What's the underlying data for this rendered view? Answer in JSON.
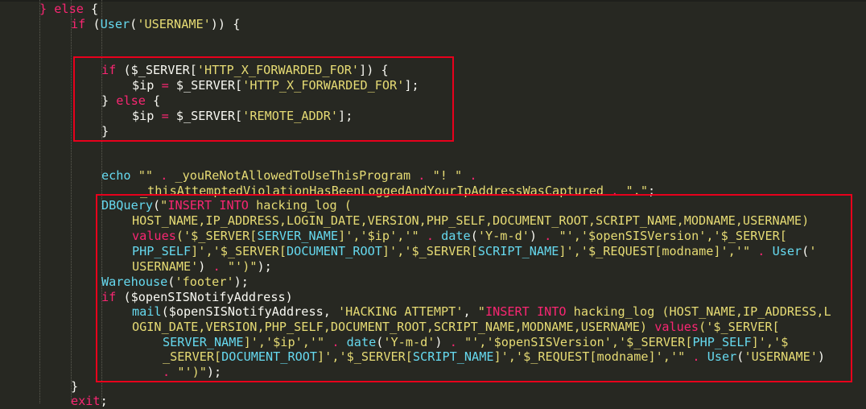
{
  "colors": {
    "background": "#272822",
    "text": "#f8f8f2",
    "keyword": "#f92672",
    "string": "#e6db74",
    "function": "#66d9ef",
    "highlight_box": "#e8001c"
  },
  "code_lines": [
    [
      [
        "kw",
        "} else"
      ],
      [
        "pl",
        " {"
      ]
    ],
    [
      [
        "kw",
        "if"
      ],
      [
        "pl",
        " ("
      ],
      [
        "fn",
        "User"
      ],
      [
        "pl",
        "("
      ],
      [
        "st",
        "'USERNAME'"
      ],
      [
        "pl",
        ")) {"
      ]
    ],
    [],
    [],
    [
      [
        "kw",
        "if"
      ],
      [
        "pl",
        " ($_SERVER["
      ],
      [
        "st",
        "'HTTP_X_FORWARDED_FOR'"
      ],
      [
        "pl",
        "]) {"
      ]
    ],
    [
      [
        "pl",
        "$ip "
      ],
      [
        "kw",
        "="
      ],
      [
        "pl",
        " $_SERVER["
      ],
      [
        "st",
        "'HTTP_X_FORWARDED_FOR'"
      ],
      [
        "pl",
        "];"
      ]
    ],
    [
      [
        "pl",
        "} "
      ],
      [
        "kw",
        "else"
      ],
      [
        "pl",
        " {"
      ]
    ],
    [
      [
        "pl",
        "$ip "
      ],
      [
        "kw",
        "="
      ],
      [
        "pl",
        " $_SERVER["
      ],
      [
        "st",
        "'REMOTE_ADDR'"
      ],
      [
        "pl",
        "];"
      ]
    ],
    [
      [
        "pl",
        "}"
      ]
    ],
    [],
    [],
    [
      [
        "fn",
        "echo"
      ],
      [
        "pl",
        " "
      ],
      [
        "st",
        "\"\""
      ],
      [
        "pl",
        " "
      ],
      [
        "kw",
        "."
      ],
      [
        "pl",
        " "
      ],
      [
        "st",
        "_youReNotAllowedToUseThisProgram"
      ],
      [
        "pl",
        " "
      ],
      [
        "kw",
        "."
      ],
      [
        "pl",
        " "
      ],
      [
        "st",
        "\"! \""
      ],
      [
        "pl",
        " "
      ],
      [
        "kw",
        "."
      ]
    ],
    [
      [
        "st",
        "_thisAttemptedViolationHasBeenLoggedAndYourIpAddressWasCaptured"
      ],
      [
        "pl",
        " "
      ],
      [
        "kw",
        "."
      ],
      [
        "pl",
        " "
      ],
      [
        "st",
        "\".\""
      ],
      [
        "pl",
        ";"
      ]
    ],
    [
      [
        "fn",
        "DBQuery"
      ],
      [
        "pl",
        "("
      ],
      [
        "st",
        "\""
      ],
      [
        "kw",
        "INSERT INTO"
      ],
      [
        "st",
        " hacking_log ("
      ]
    ],
    [
      [
        "st",
        "HOST_NAME,IP_ADDRESS,LOGIN_DATE,VERSION,PHP_SELF,DOCUMENT_ROOT,SCRIPT_NAME,MODNAME,USERNAME)"
      ]
    ],
    [
      [
        "kw",
        "values"
      ],
      [
        "st",
        "('$_SERVER["
      ],
      [
        "fn",
        "SERVER_NAME"
      ],
      [
        "st",
        "]','$ip','\""
      ],
      [
        "pl",
        " "
      ],
      [
        "kw",
        "."
      ],
      [
        "pl",
        " "
      ],
      [
        "fn",
        "date"
      ],
      [
        "pl",
        "("
      ],
      [
        "st",
        "'Y-m-d'"
      ],
      [
        "pl",
        ") "
      ],
      [
        "kw",
        "."
      ],
      [
        "pl",
        " "
      ],
      [
        "st",
        "\"','$openSISVersion','$_SERVER["
      ]
    ],
    [
      [
        "fn",
        "PHP_SELF"
      ],
      [
        "st",
        "]','$_SERVER["
      ],
      [
        "fn",
        "DOCUMENT_ROOT"
      ],
      [
        "st",
        "]','$_SERVER["
      ],
      [
        "fn",
        "SCRIPT_NAME"
      ],
      [
        "st",
        "]','$_REQUEST[modname]','\""
      ],
      [
        "pl",
        " "
      ],
      [
        "kw",
        "."
      ],
      [
        "pl",
        " "
      ],
      [
        "fn",
        "User"
      ],
      [
        "pl",
        "("
      ],
      [
        "st",
        "'"
      ]
    ],
    [
      [
        "st",
        "USERNAME'"
      ],
      [
        "pl",
        ") "
      ],
      [
        "kw",
        "."
      ],
      [
        "pl",
        " "
      ],
      [
        "st",
        "\"')\""
      ],
      [
        "pl",
        ");"
      ]
    ],
    [
      [
        "fn",
        "Warehouse"
      ],
      [
        "pl",
        "("
      ],
      [
        "st",
        "'footer'"
      ],
      [
        "pl",
        ");"
      ]
    ],
    [
      [
        "kw",
        "if"
      ],
      [
        "pl",
        " ($openSISNotifyAddress)"
      ]
    ],
    [
      [
        "fn",
        "mail"
      ],
      [
        "pl",
        "($openSISNotifyAddress, "
      ],
      [
        "st",
        "'HACKING ATTEMPT'"
      ],
      [
        "pl",
        ", "
      ],
      [
        "st",
        "\""
      ],
      [
        "kw",
        "INSERT INTO"
      ],
      [
        "st",
        " hacking_log (HOST_NAME,IP_ADDRESS,L"
      ]
    ],
    [
      [
        "st",
        "OGIN_DATE,VERSION,PHP_SELF,DOCUMENT_ROOT,SCRIPT_NAME,MODNAME,USERNAME) "
      ],
      [
        "kw",
        "values"
      ],
      [
        "st",
        "('$_SERVER["
      ]
    ],
    [
      [
        "fn",
        "SERVER_NAME"
      ],
      [
        "st",
        "]','$ip','\""
      ],
      [
        "pl",
        " "
      ],
      [
        "kw",
        "."
      ],
      [
        "pl",
        " "
      ],
      [
        "fn",
        "date"
      ],
      [
        "pl",
        "("
      ],
      [
        "st",
        "'Y-m-d'"
      ],
      [
        "pl",
        ") "
      ],
      [
        "kw",
        "."
      ],
      [
        "pl",
        " "
      ],
      [
        "st",
        "\"','$openSISVersion','$_SERVER["
      ],
      [
        "fn",
        "PHP_SELF"
      ],
      [
        "st",
        "]','$"
      ]
    ],
    [
      [
        "st",
        "_SERVER["
      ],
      [
        "fn",
        "DOCUMENT_ROOT"
      ],
      [
        "st",
        "]','$_SERVER["
      ],
      [
        "fn",
        "SCRIPT_NAME"
      ],
      [
        "st",
        "]','$_REQUEST[modname]','\""
      ],
      [
        "pl",
        " "
      ],
      [
        "kw",
        "."
      ],
      [
        "pl",
        " "
      ],
      [
        "fn",
        "User"
      ],
      [
        "pl",
        "("
      ],
      [
        "st",
        "'USERNAME'"
      ],
      [
        "pl",
        ")"
      ]
    ],
    [
      [
        "kw",
        "."
      ],
      [
        "pl",
        " "
      ],
      [
        "st",
        "\"')\""
      ],
      [
        "pl",
        ");"
      ]
    ],
    [
      [
        "pl",
        "}"
      ]
    ],
    [
      [
        "kw",
        "exit"
      ],
      [
        "pl",
        ";"
      ]
    ]
  ]
}
